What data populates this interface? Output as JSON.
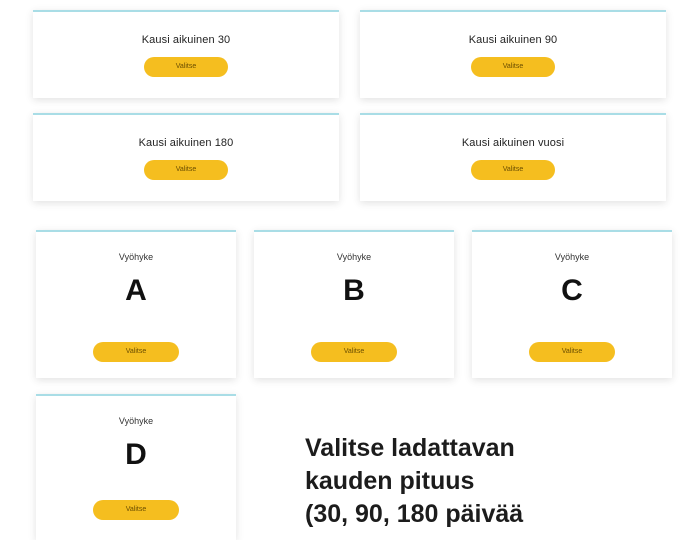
{
  "season_cards": [
    {
      "title": "Kausi aikuinen 30",
      "button": "Valitse"
    },
    {
      "title": "Kausi aikuinen 90",
      "button": "Valitse"
    },
    {
      "title": "Kausi aikuinen 180",
      "button": "Valitse"
    },
    {
      "title": "Kausi aikuinen vuosi",
      "button": "Valitse"
    }
  ],
  "zone_cards": [
    {
      "label": "Vyöhyke",
      "letter": "A",
      "button": "Valitse"
    },
    {
      "label": "Vyöhyke",
      "letter": "B",
      "button": "Valitse"
    },
    {
      "label": "Vyöhyke",
      "letter": "C",
      "button": "Valitse"
    },
    {
      "label": "Vyöhyke",
      "letter": "D",
      "button": "Valitse"
    }
  ],
  "instruction": "Valitse ladattavan\nkauden pituus\n(30, 90, 180 päivää",
  "colors": {
    "button": "#f5be1f",
    "card_border": "#a9dde6"
  }
}
